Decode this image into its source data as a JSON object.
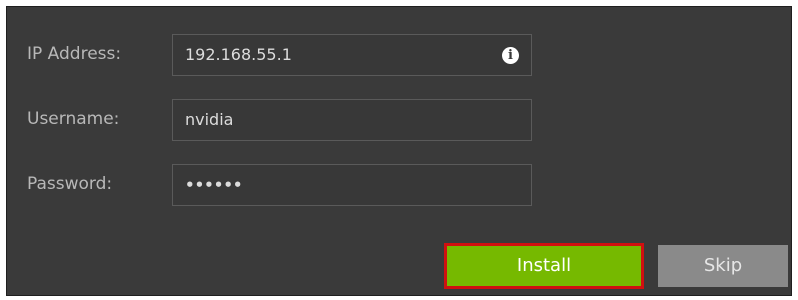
{
  "form": {
    "ip_label": "IP Address:",
    "ip_value": "192.168.55.1",
    "info_icon": "info-icon",
    "username_label": "Username:",
    "username_value": "nvidia",
    "password_label": "Password:",
    "password_value": "••••••"
  },
  "actions": {
    "install_label": "Install",
    "skip_label": "Skip"
  },
  "colors": {
    "dialog_bg": "#3a3a3a",
    "install_bg": "#76b900",
    "install_highlight": "#d01010",
    "skip_bg": "#8a8a8a"
  }
}
